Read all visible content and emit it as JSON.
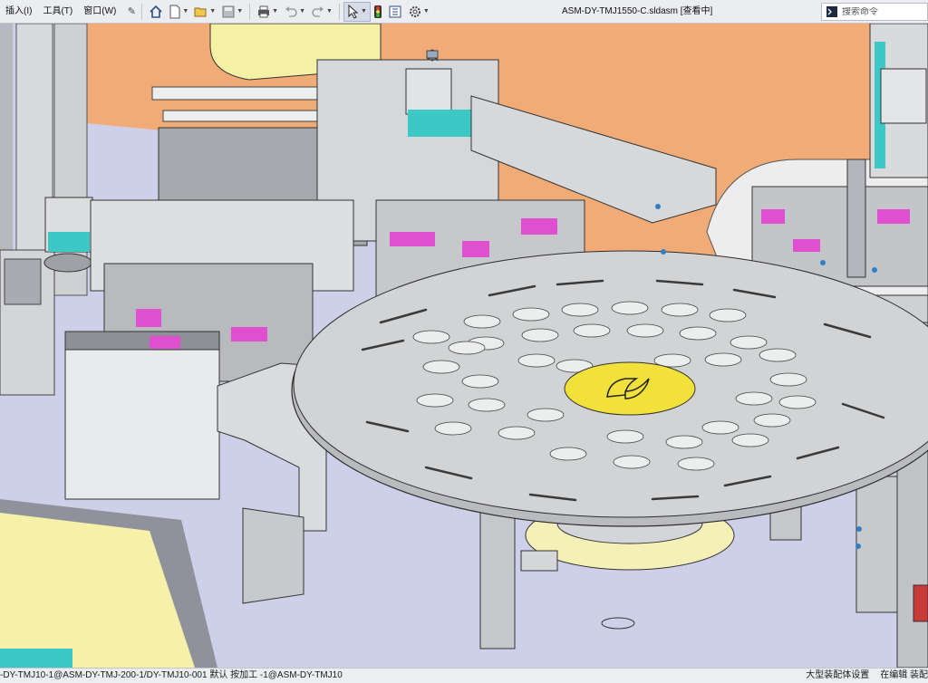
{
  "menu": {
    "items": [
      "插入(I)",
      "工具(T)",
      "窗口(W)"
    ]
  },
  "document": {
    "title": "ASM-DY-TMJ1550-C.sldasm [查看中]"
  },
  "search": {
    "placeholder": "搜索命令"
  },
  "statusbar": {
    "path": "-DY-TMJ10-1@ASM-DY-TMJ-200-1/DY-TMJ10-001 默认 按加工 -1@ASM-DY-TMJ10",
    "mode": "大型装配体设置",
    "edit_state": "在编辑 装配"
  },
  "colors": {
    "background": "#cfd2e8",
    "wall": "#f0ab77",
    "metal": "#c9cacc",
    "accent_pink": "#e04fd0",
    "accent_teal": "#3cc9c6",
    "logo_yellow": "#f2e13a"
  }
}
